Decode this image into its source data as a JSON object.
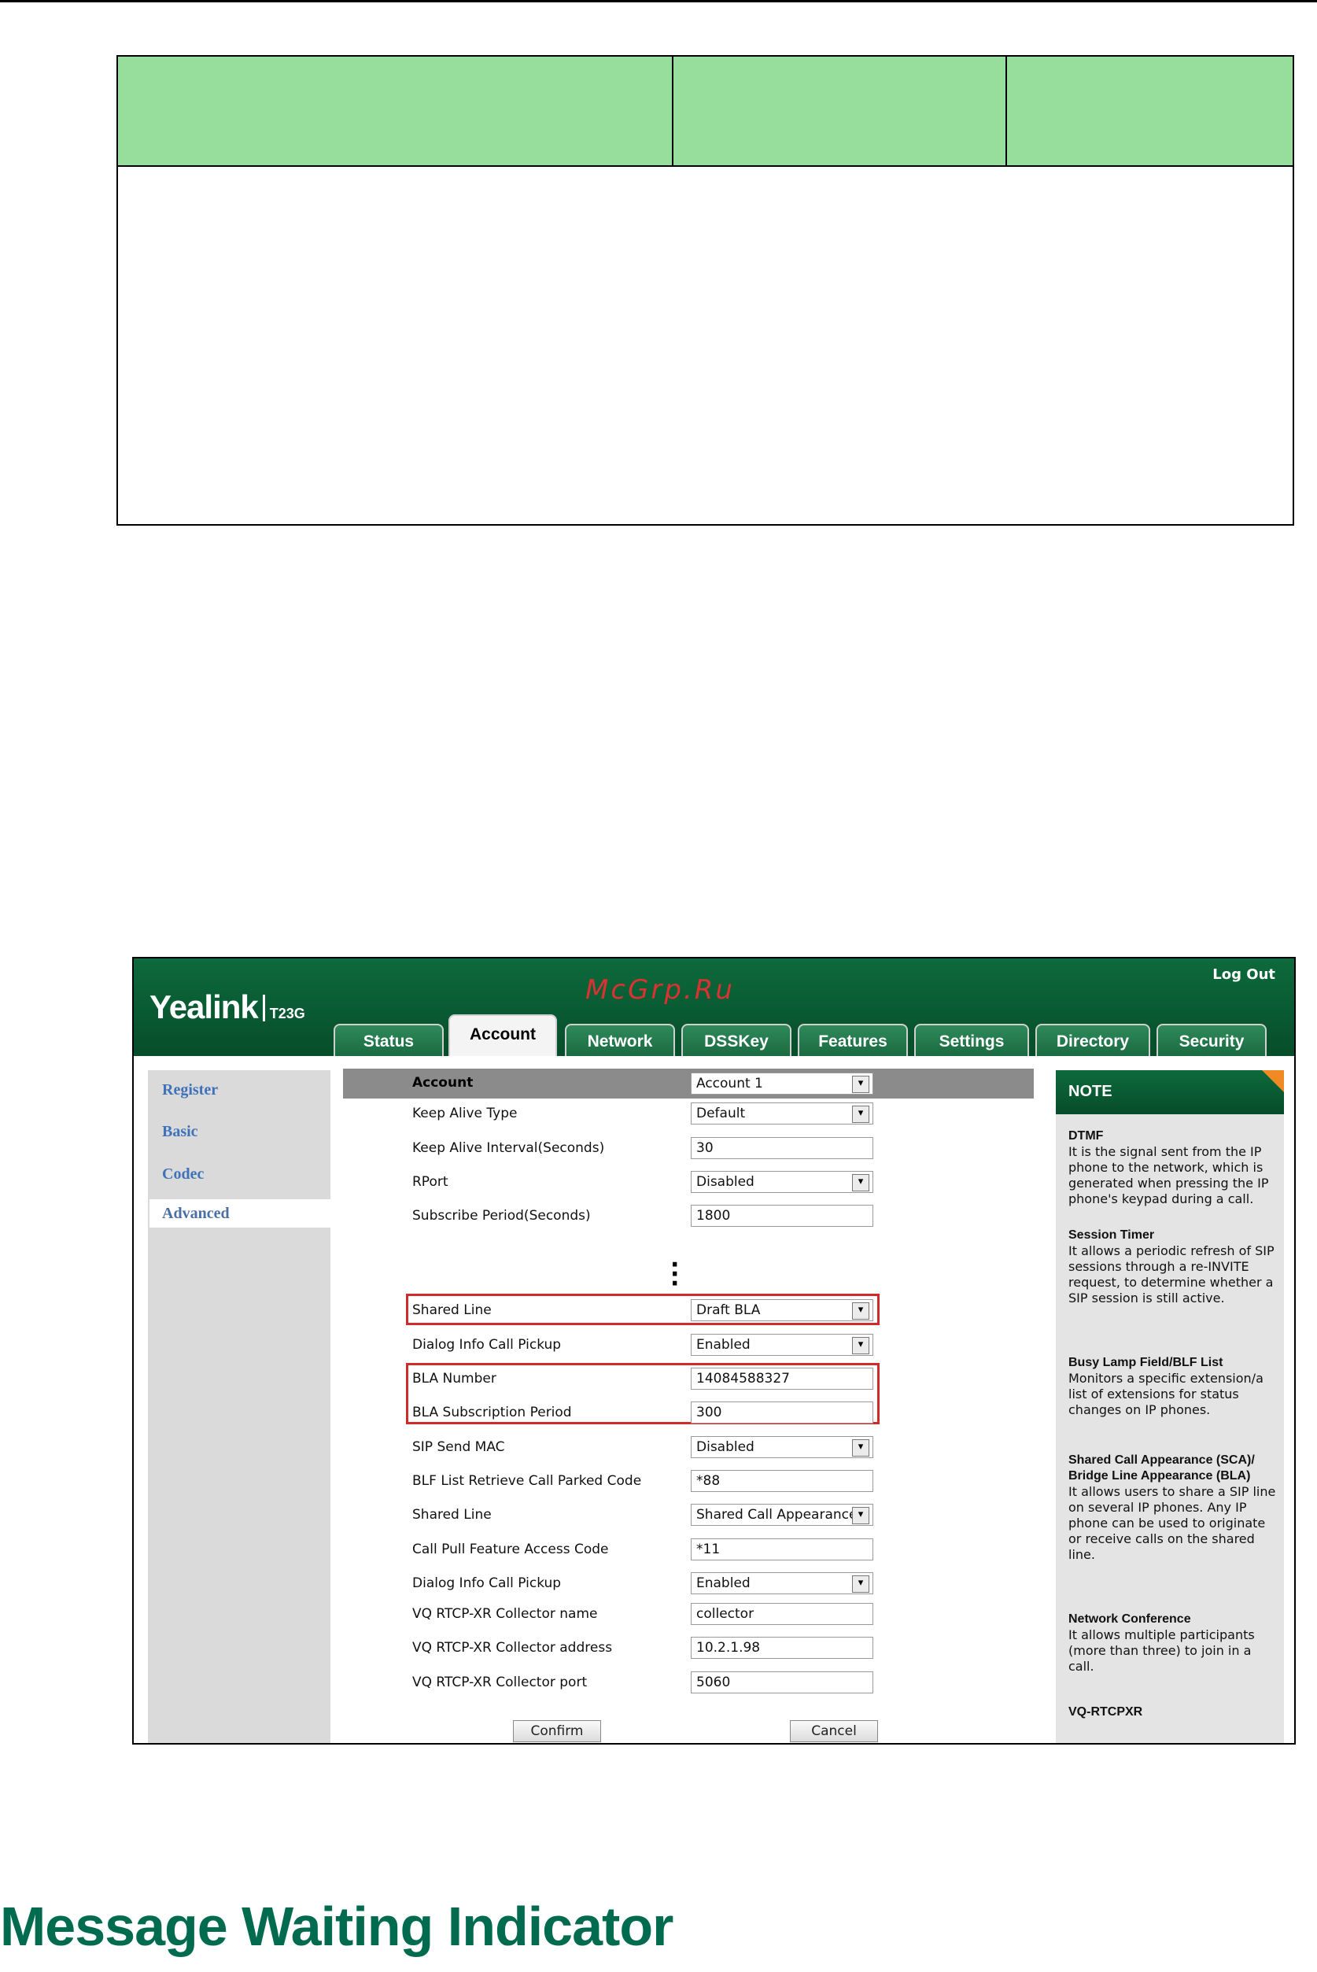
{
  "ui": {
    "brand": "Yealink",
    "model": "T23G",
    "watermark": "McGrp.Ru",
    "logout": "Log Out",
    "tabs": [
      "Status",
      "Account",
      "Network",
      "DSSKey",
      "Features",
      "Settings",
      "Directory",
      "Security"
    ],
    "active_tab": "Account",
    "leftnav": [
      "Register",
      "Basic",
      "Codec",
      "Advanced"
    ],
    "active_nav": "Advanced",
    "account_row": {
      "label": "Account",
      "value": "Account 1"
    },
    "rows_top": [
      {
        "label": "Keep Alive Type",
        "value": "Default",
        "type": "select"
      },
      {
        "label": "Keep Alive Interval(Seconds)",
        "value": "30",
        "type": "text"
      },
      {
        "label": "RPort",
        "value": "Disabled",
        "type": "select"
      },
      {
        "label": "Subscribe Period(Seconds)",
        "value": "1800",
        "type": "text"
      }
    ],
    "rows_bottom": [
      {
        "label": "Shared Line",
        "value": "Draft BLA",
        "type": "select"
      },
      {
        "label": "Dialog Info Call Pickup",
        "value": "Enabled",
        "type": "select"
      },
      {
        "label": "BLA Number",
        "value": "14084588327",
        "type": "text"
      },
      {
        "label": "BLA Subscription Period",
        "value": "300",
        "type": "text"
      },
      {
        "label": "SIP Send MAC",
        "value": "Disabled",
        "type": "select"
      },
      {
        "label": "BLF List Retrieve Call Parked Code",
        "value": "*88",
        "type": "text"
      },
      {
        "label": "Shared Line",
        "value": "Shared Call Appearance",
        "type": "select"
      },
      {
        "label": "Call Pull Feature Access Code",
        "value": "*11",
        "type": "text"
      },
      {
        "label": "Dialog Info Call Pickup",
        "value": "Enabled",
        "type": "select"
      },
      {
        "label": "VQ RTCP-XR Collector name",
        "value": "collector",
        "type": "text"
      },
      {
        "label": "VQ RTCP-XR Collector address",
        "value": "10.2.1.98",
        "type": "text"
      },
      {
        "label": "VQ RTCP-XR Collector port",
        "value": "5060",
        "type": "text"
      }
    ],
    "confirm": "Confirm",
    "cancel": "Cancel",
    "note": {
      "title": "NOTE",
      "sections": [
        {
          "title": "DTMF",
          "text": "It is the signal sent from the IP phone to the network, which is generated when pressing the IP phone's keypad during a call."
        },
        {
          "title": "Session Timer",
          "text": "It allows a periodic refresh of SIP sessions through a re-INVITE request, to determine whether a SIP session is still active."
        },
        {
          "title": "Busy Lamp Field/BLF List",
          "text": "Monitors a specific extension/a list of extensions for status changes on IP phones."
        },
        {
          "title": "Shared Call Appearance (SCA)/ Bridge Line Appearance (BLA)",
          "text": "It allows users to share a SIP line on several IP phones. Any IP phone can be used to originate or receive calls on the shared line."
        },
        {
          "title": "Network Conference",
          "text": "It allows multiple participants (more than three) to join in a call."
        },
        {
          "title": "VQ-RTCPXR",
          "text": ""
        }
      ]
    }
  },
  "doc": {
    "section_title": "Message Waiting Indicator"
  }
}
